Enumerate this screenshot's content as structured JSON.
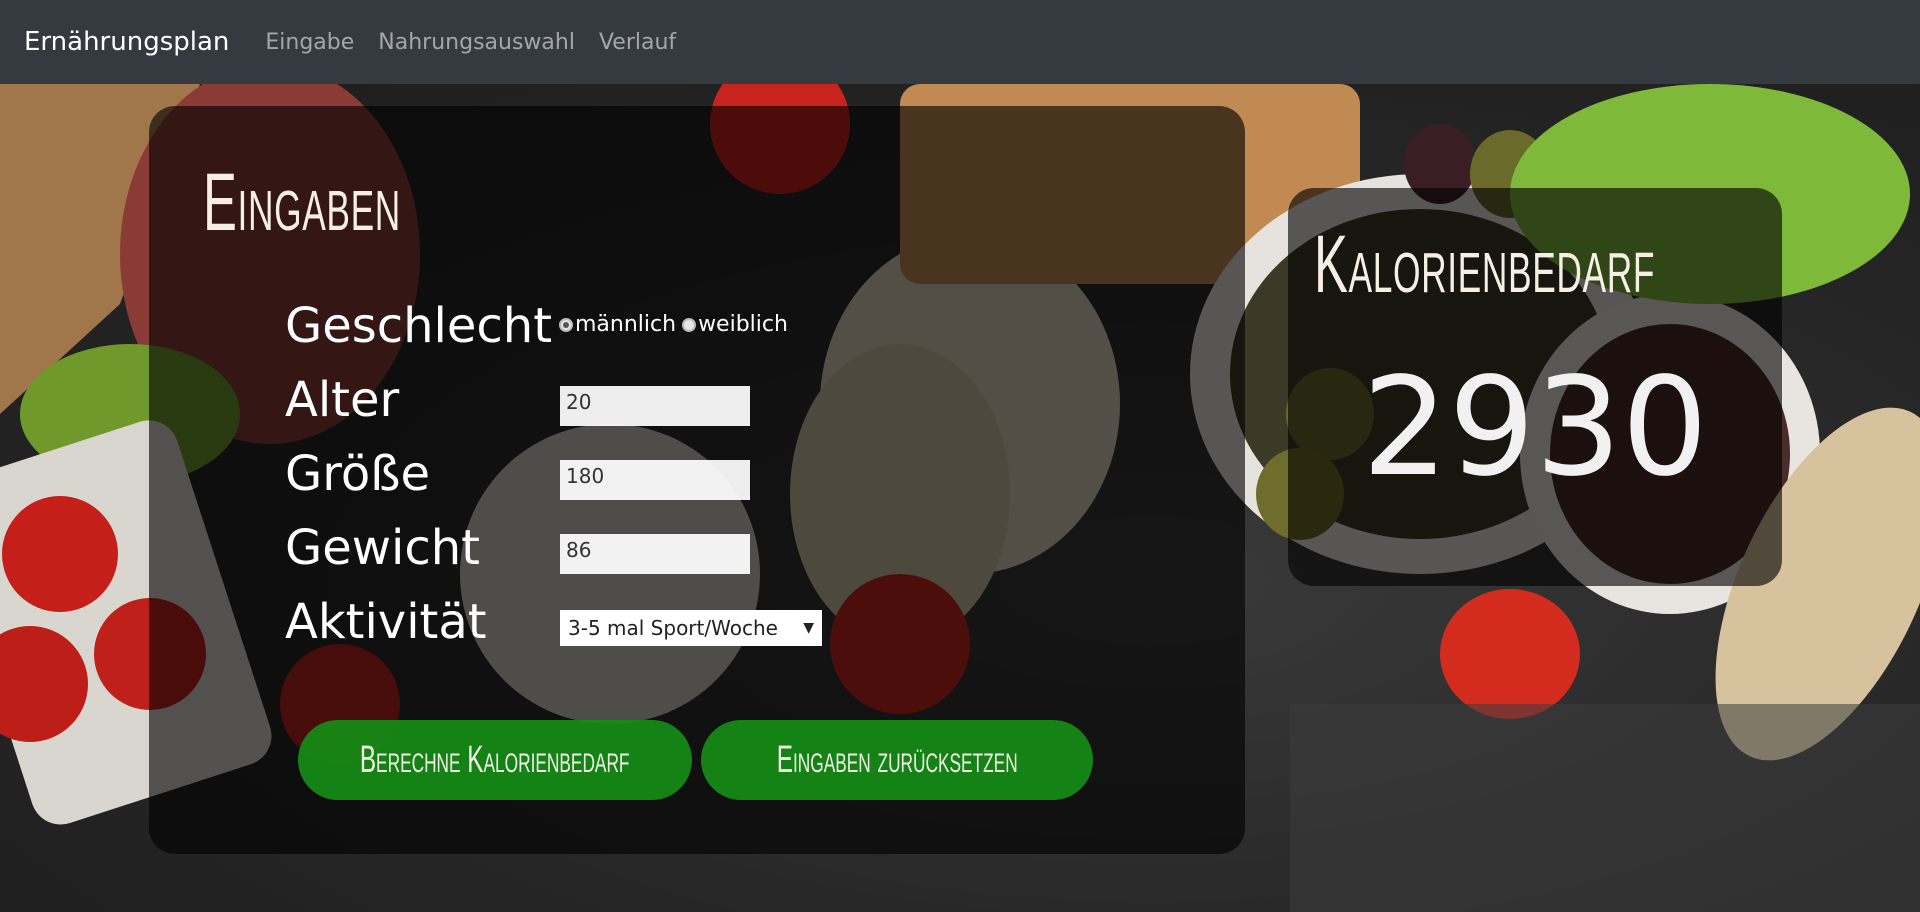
{
  "navbar": {
    "brand": "Ernährungsplan",
    "links": [
      "Eingabe",
      "Nahrungsauswahl",
      "Verlauf"
    ]
  },
  "input_panel": {
    "title": "Eingaben",
    "fields": {
      "gender": {
        "label": "Geschlecht",
        "options": [
          "männlich",
          "weiblich"
        ],
        "selected": "männlich"
      },
      "age": {
        "label": "Alter",
        "value": "20"
      },
      "height": {
        "label": "Größe",
        "value": "180"
      },
      "weight": {
        "label": "Gewicht",
        "value": "86"
      },
      "activity": {
        "label": "Aktivität",
        "selected": "3-5 mal Sport/Woche"
      }
    },
    "buttons": {
      "calculate": "Berechne Kalorienbedarf",
      "reset": "Eingaben zurücksetzen"
    }
  },
  "result_panel": {
    "title": "Kalorienbedarf",
    "value": "2930"
  },
  "colors": {
    "navbar_bg": "#343a40",
    "button_green": "#168c16",
    "panel_overlay": "rgba(0,0,0,0.62)"
  }
}
